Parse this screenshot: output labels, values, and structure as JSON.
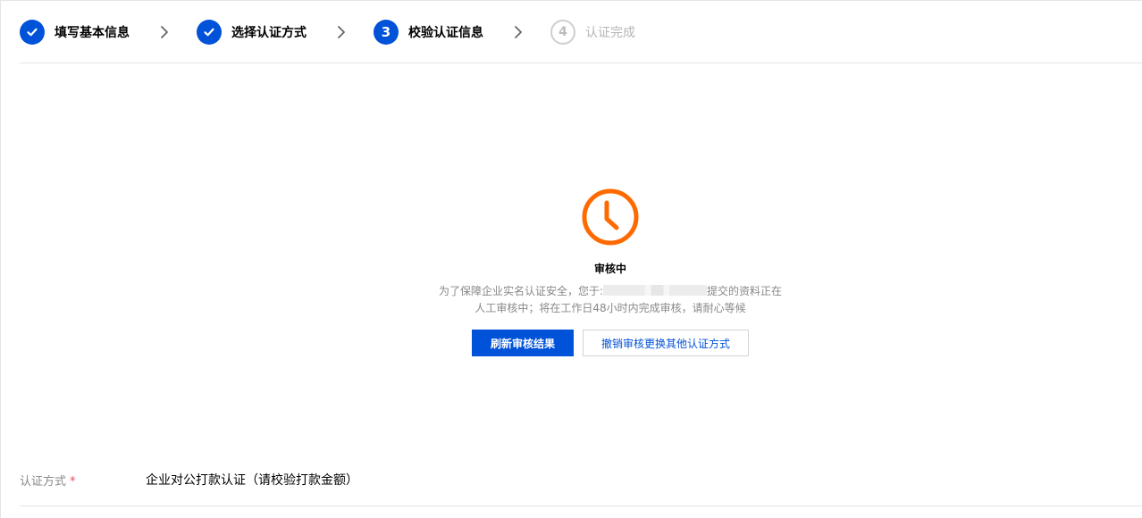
{
  "steps": [
    {
      "number": "1",
      "label": "填写基本信息",
      "state": "done"
    },
    {
      "number": "2",
      "label": "选择认证方式",
      "state": "done"
    },
    {
      "number": "3",
      "label": "校验认证信息",
      "state": "current"
    },
    {
      "number": "4",
      "label": "认证完成",
      "state": "pending"
    }
  ],
  "status": {
    "icon": "clock-icon",
    "title": "审核中",
    "desc_prefix": "为了保障企业实名认证安全，您于:",
    "desc_suffix": "提交的资料正在",
    "desc_line2": "人工审核中；将在工作日48小时内完成审核，请耐心等候"
  },
  "buttons": {
    "refresh_label": "刷新审核结果",
    "cancel_label": "撤销审核更换其他认证方式"
  },
  "form": {
    "method_label": "认证方式",
    "required_mark": "*",
    "method_value": "企业对公打款认证（请校验打款金额）"
  },
  "colors": {
    "primary": "#0052d9",
    "pending_icon": "#ff6a00",
    "required": "#e34d59"
  }
}
